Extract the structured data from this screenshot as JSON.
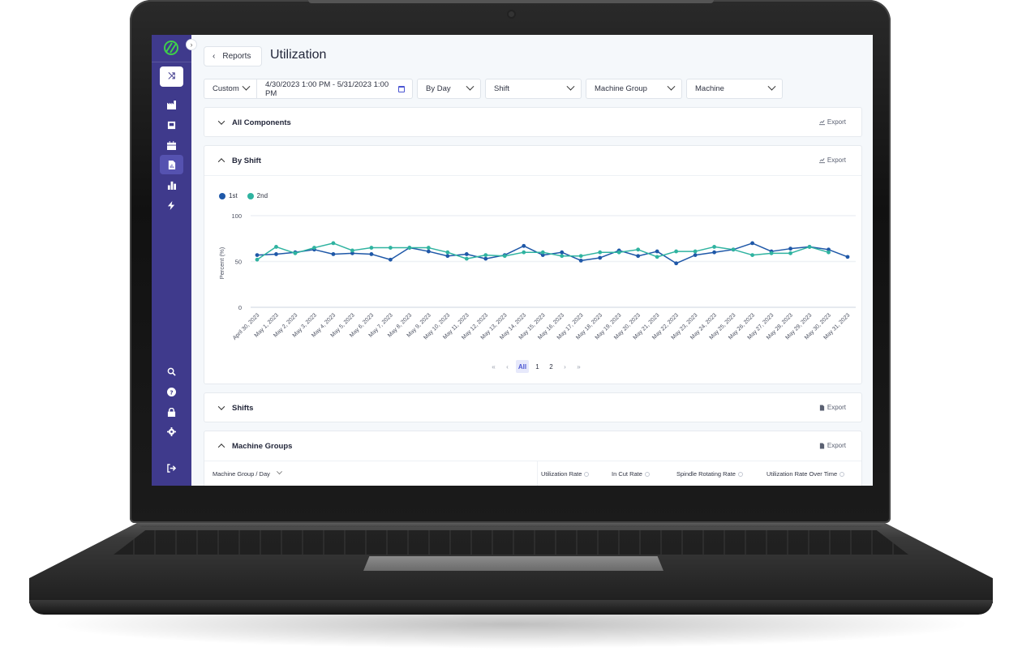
{
  "sidebar": {
    "collapse_icon": "chevron-right-icon",
    "top_button_icon": "shuffle-icon",
    "items": [
      {
        "icon": "factory-icon",
        "active": false
      },
      {
        "icon": "machine-icon",
        "active": false
      },
      {
        "icon": "calendar-icon",
        "active": false
      },
      {
        "icon": "report-document-icon",
        "active": true
      },
      {
        "icon": "bar-chart-icon",
        "active": false
      },
      {
        "icon": "lightning-icon",
        "active": false
      }
    ],
    "bottom_items": [
      {
        "icon": "search-icon"
      },
      {
        "icon": "help-icon"
      },
      {
        "icon": "lock-icon"
      },
      {
        "icon": "gear-icon"
      },
      {
        "icon": "logout-icon"
      }
    ]
  },
  "header": {
    "back_label": "Reports",
    "title": "Utilization"
  },
  "filters": {
    "range_type": "Custom",
    "date_range": "4/30/2023 1:00 PM - 5/31/2023 1:00 PM",
    "grouping": "By Day",
    "shift": "Shift",
    "machine_group": "Machine Group",
    "machine": "Machine"
  },
  "panels": {
    "all_components": {
      "title": "All Components",
      "export": "Export",
      "expanded": false
    },
    "by_shift": {
      "title": "By Shift",
      "export": "Export",
      "expanded": true
    },
    "shifts": {
      "title": "Shifts",
      "export": "Export",
      "expanded": false
    },
    "machine_groups": {
      "title": "Machine Groups",
      "export": "Export",
      "expanded": true,
      "columns": [
        "Machine Group / Day",
        "Utilization Rate",
        "In Cut Rate",
        "Spindle Rotating Rate",
        "Utilization Rate Over Time"
      ]
    }
  },
  "pager": {
    "first": "«",
    "prev": "‹",
    "pages": [
      "All",
      "1",
      "2"
    ],
    "active": "All",
    "next": "›",
    "last": "»"
  },
  "colors": {
    "sidebar": "#3f3a8c",
    "accent": "#4b56d2",
    "series_1st": "#1f58a8",
    "series_2nd": "#2fb3a0"
  },
  "chart_data": {
    "type": "line",
    "title": "",
    "xlabel": "",
    "ylabel": "Percent (%)",
    "ylim": [
      0,
      100
    ],
    "yticks": [
      0,
      50,
      100
    ],
    "grid": true,
    "legend": "top-left",
    "categories": [
      "April 30, 2023",
      "May 1, 2023",
      "May 2, 2023",
      "May 3, 2023",
      "May 4, 2023",
      "May 5, 2023",
      "May 6, 2023",
      "May 7, 2023",
      "May 8, 2023",
      "May 9, 2023",
      "May 10, 2023",
      "May 11, 2023",
      "May 12, 2023",
      "May 13, 2023",
      "May 14, 2023",
      "May 15, 2023",
      "May 16, 2023",
      "May 17, 2023",
      "May 18, 2023",
      "May 19, 2023",
      "May 20, 2023",
      "May 21, 2023",
      "May 22, 2023",
      "May 23, 2023",
      "May 24, 2023",
      "May 25, 2023",
      "May 26, 2023",
      "May 27, 2023",
      "May 28, 2023",
      "May 29, 2023",
      "May 30, 2023",
      "May 31, 2023"
    ],
    "series": [
      {
        "name": "1st",
        "color": "#1f58a8",
        "values": [
          57,
          58,
          60,
          63,
          58,
          59,
          58,
          52,
          65,
          61,
          56,
          58,
          53,
          57,
          67,
          57,
          60,
          51,
          54,
          62,
          56,
          61,
          48,
          57,
          60,
          63,
          70,
          61,
          64,
          66,
          63,
          55
        ]
      },
      {
        "name": "2nd",
        "color": "#2fb3a0",
        "values": [
          52,
          66,
          59,
          65,
          70,
          62,
          65,
          65,
          65,
          65,
          60,
          53,
          57,
          56,
          60,
          60,
          56,
          56,
          60,
          60,
          63,
          55,
          61,
          61,
          66,
          63,
          57,
          59,
          59,
          66,
          60,
          null
        ]
      }
    ]
  }
}
